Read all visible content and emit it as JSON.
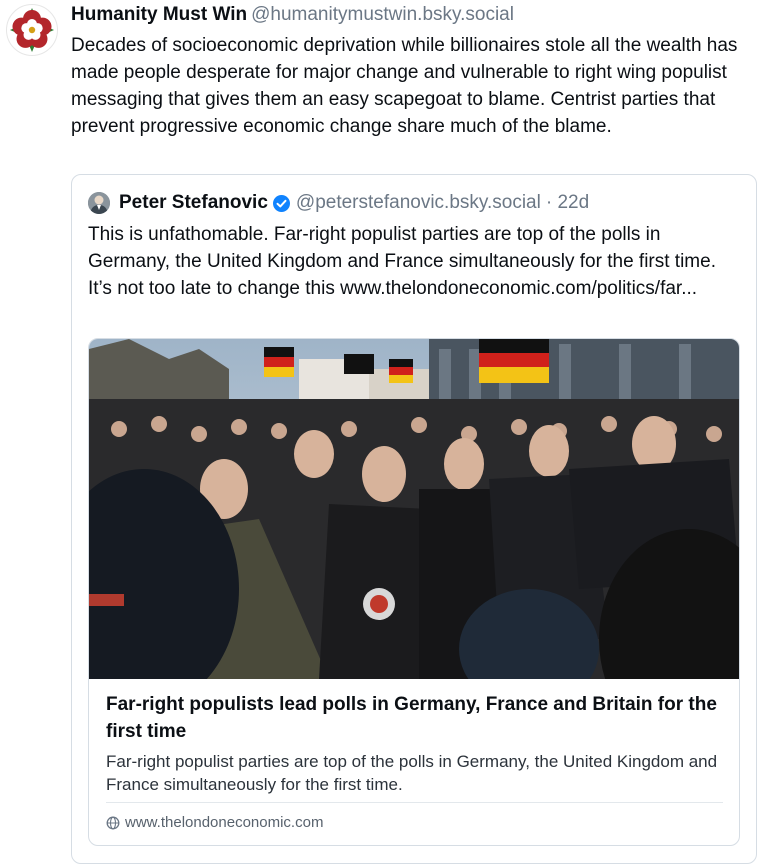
{
  "post": {
    "author": "Humanity Must Win",
    "handle": "@humanitymustwin.bsky.social",
    "text": "Decades of socioeconomic deprivation while billionaires stole all the wealth has made people desperate for major change and vulnerable to right wing populist messaging that gives them an easy scapegoat to blame. Centrist parties that prevent progressive economic change share much of the blame."
  },
  "quote": {
    "author": "Peter Stefanovic",
    "handle": "@peterstefanovic.bsky.social",
    "age": "· 22d",
    "text": "This is unfathomable. Far-right populist parties are top of the polls in Germany, the United Kingdom and France simultaneously for the first time. It’s not too late to change this www.thelondoneconomic.com/politics/far...",
    "card": {
      "title": "Far-right populists lead polls in Germany, France and Britain for the first time",
      "description": "Far-right populist parties are top of the polls in Germany, the United Kingdom and France simultaneously for the first time.",
      "domain": "www.thelondoneconomic.com"
    }
  },
  "colors": {
    "handle_gray": "#6b7785",
    "border": "#d6dde4",
    "verified_blue": "#1083fe",
    "avatar_rose_red": "#b3262b"
  },
  "icons": [
    "tudor-rose-avatar",
    "verified-check-icon",
    "globe-icon"
  ]
}
